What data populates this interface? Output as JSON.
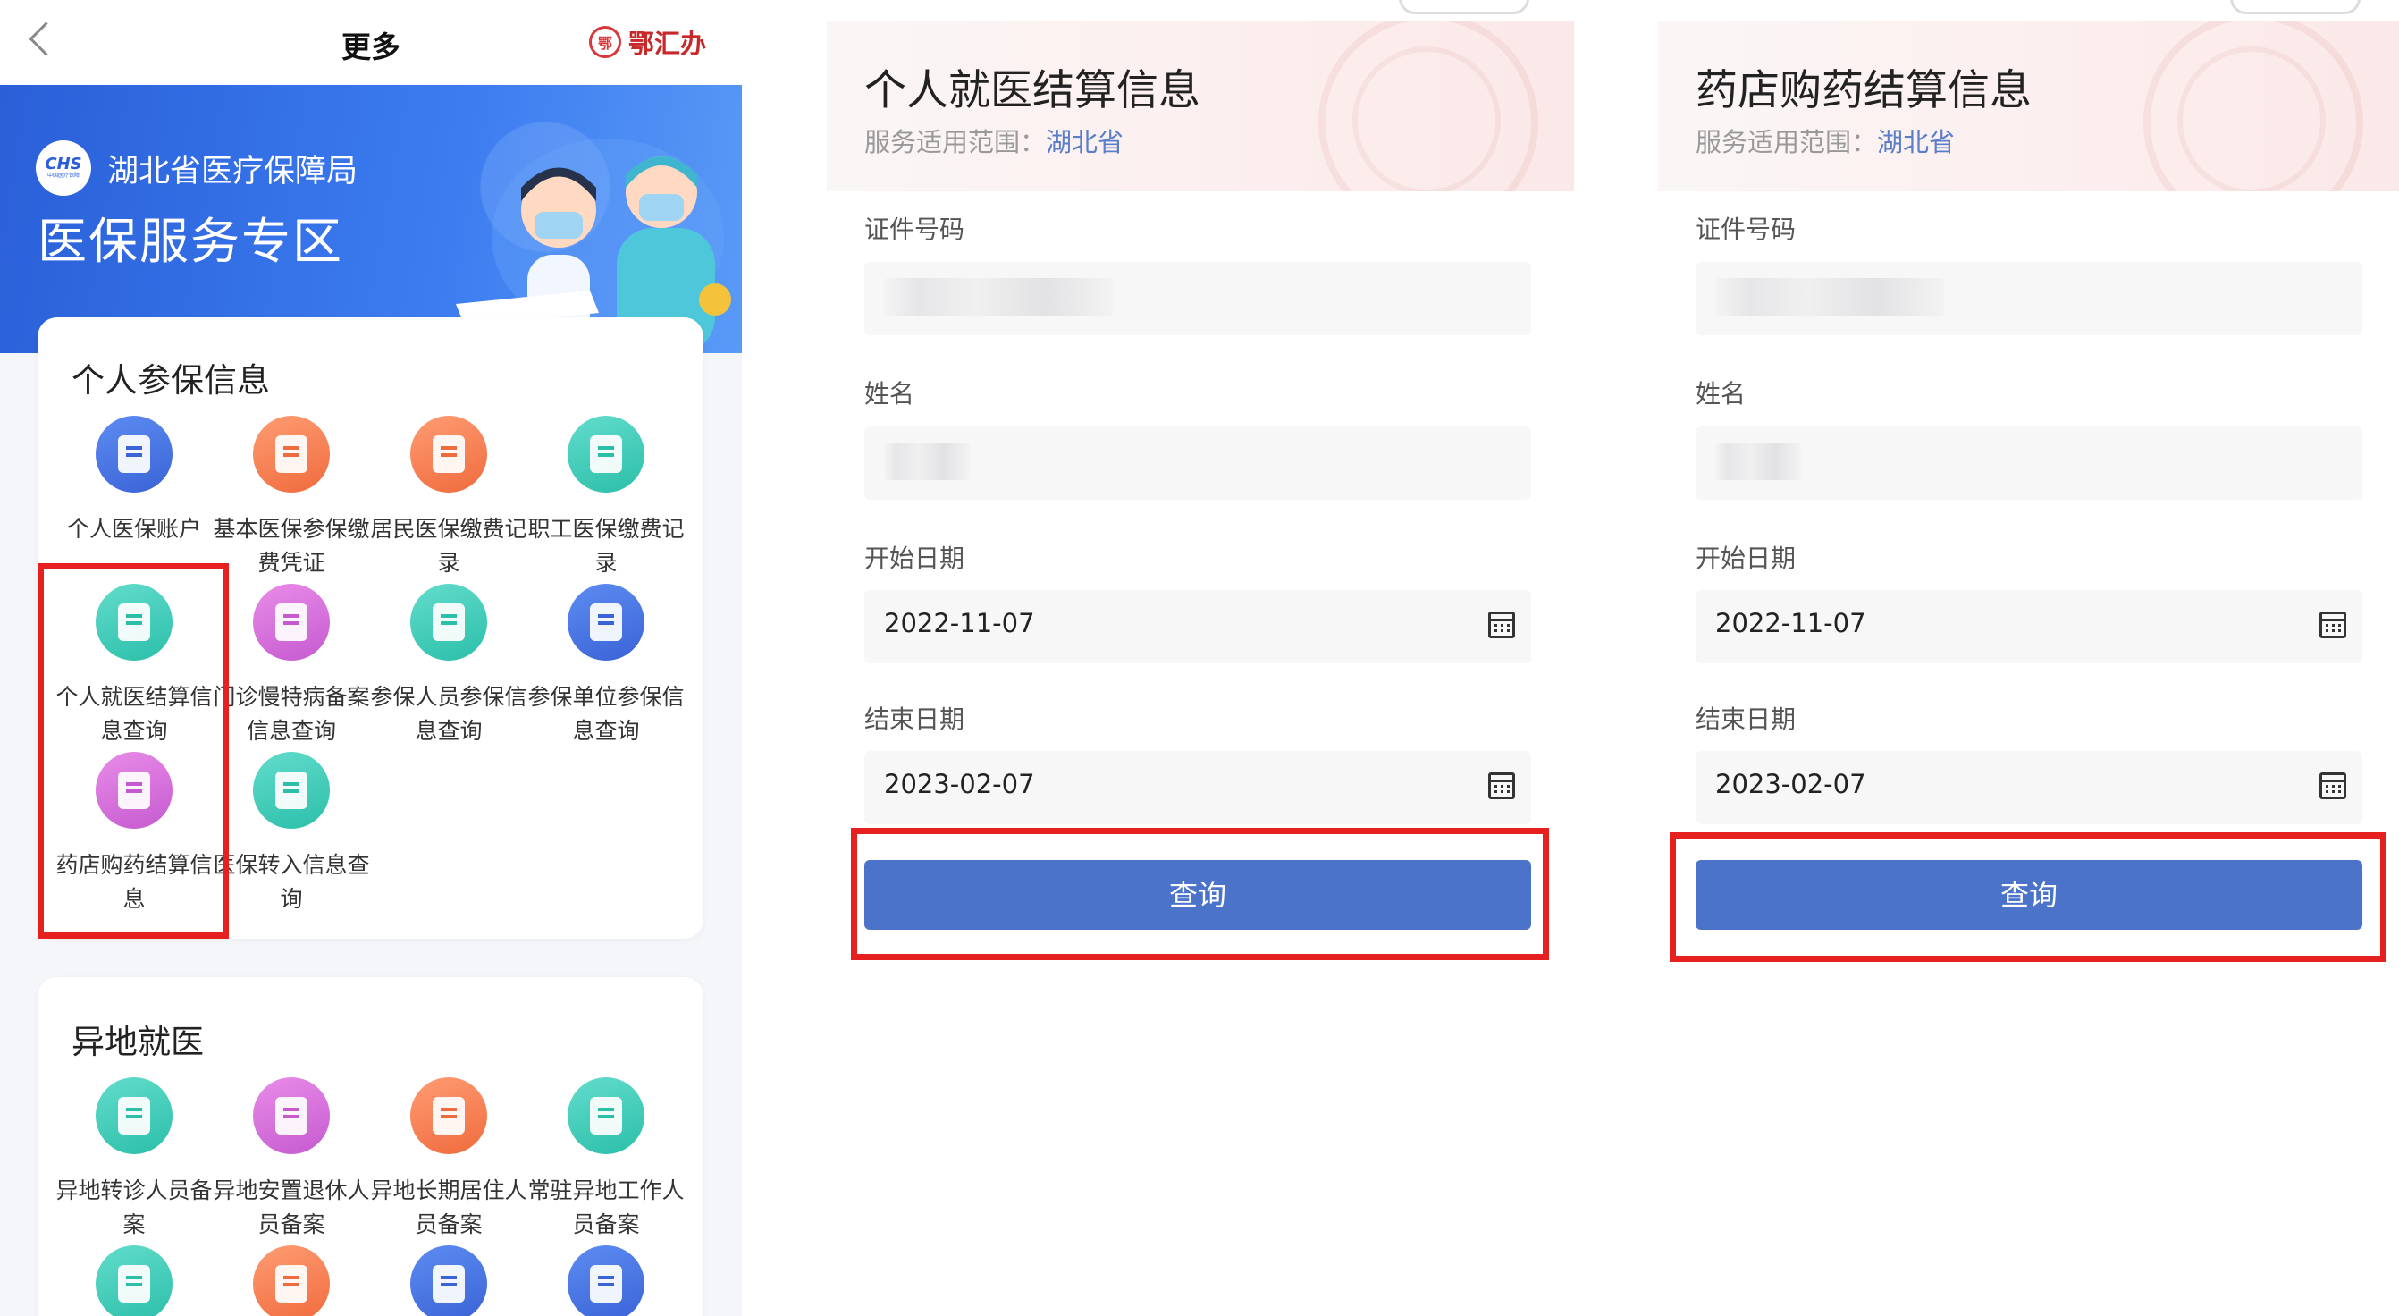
{
  "left_panel": {
    "header": {
      "title": "更多",
      "brand": "鄂汇办",
      "brand_seal": "鄂"
    },
    "banner": {
      "logo_text": "CHS",
      "logo_subtext": "中国医疗保障",
      "bureau": "湖北省医疗保障局",
      "zone": "医保服务专区"
    },
    "section1": {
      "title": "个人参保信息",
      "items": [
        {
          "label": "个人医保账户",
          "icon": "wallet-icon",
          "color": "blue"
        },
        {
          "label": "基本医保参保缴费凭证",
          "icon": "certificate-icon",
          "color": "orange"
        },
        {
          "label": "居民医保缴费记录",
          "icon": "receipt-icon",
          "color": "orange"
        },
        {
          "label": "职工医保缴费记录",
          "icon": "receipt-icon",
          "color": "teal"
        },
        {
          "label": "个人就医结算信息查询",
          "icon": "medical-record-icon",
          "color": "teal"
        },
        {
          "label": "门诊慢特病备案信息查询",
          "icon": "clipboard-cross-icon",
          "color": "purple"
        },
        {
          "label": "参保人员参保信息查询",
          "icon": "person-icon",
          "color": "teal"
        },
        {
          "label": "参保单位参保信息查询",
          "icon": "document-icon",
          "color": "blue"
        },
        {
          "label": "药店购药结算信息",
          "icon": "pharmacy-icon",
          "color": "purple"
        },
        {
          "label": "医保转入信息查询",
          "icon": "person-transfer-icon",
          "color": "teal"
        }
      ]
    },
    "section2": {
      "title": "异地就医",
      "items": [
        {
          "label": "异地转诊人员备案",
          "icon": "edit-icon",
          "color": "teal"
        },
        {
          "label": "异地安置退休人员备案",
          "icon": "home-cross-icon",
          "color": "purple"
        },
        {
          "label": "异地长期居住人员备案",
          "icon": "hospital-door-icon",
          "color": "orange"
        },
        {
          "label": "常驻异地工作人员备案",
          "icon": "house-icon",
          "color": "teal"
        },
        {
          "label": "",
          "icon": "house-icon",
          "color": "teal"
        },
        {
          "label": "",
          "icon": "hospital-icon",
          "color": "orange"
        },
        {
          "label": "",
          "icon": "medical-box-icon",
          "color": "blue"
        },
        {
          "label": "",
          "icon": "building-icon",
          "color": "blue"
        }
      ]
    }
  },
  "form_medical": {
    "title": "个人就医结算信息",
    "scope_label": "服务适用范围：",
    "scope_value": "湖北省",
    "id_label": "证件号码",
    "name_label": "姓名",
    "start_label": "开始日期",
    "start_value": "2022-11-07",
    "end_label": "结束日期",
    "end_value": "2023-02-07",
    "button": "查询"
  },
  "form_pharmacy": {
    "title": "药店购药结算信息",
    "scope_label": "服务适用范围：",
    "scope_value": "湖北省",
    "id_label": "证件号码",
    "name_label": "姓名",
    "start_label": "开始日期",
    "start_value": "2022-11-07",
    "end_label": "结束日期",
    "end_value": "2023-02-07",
    "button": "查询"
  },
  "colors": {
    "primary_button": "#4a73c9",
    "banner": "#2a5fd8",
    "highlight": "#e61f1f",
    "scope_province": "#5b7ec9"
  }
}
